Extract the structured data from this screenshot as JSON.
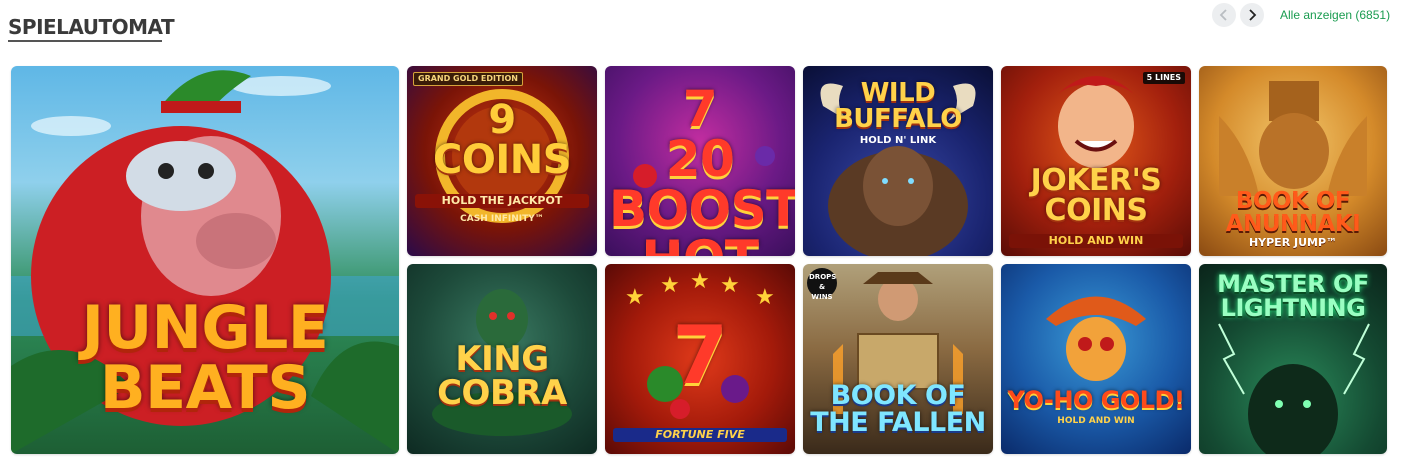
{
  "header": {
    "title": "SPIELAUTOMAT",
    "show_all": "Alle anzeigen (6851)",
    "prev_icon": "chevron-left-icon",
    "next_icon": "chevron-right-icon",
    "accent_color": "#1a9c50"
  },
  "games": [
    {
      "title": "JUNGLE\nBEATS"
    },
    {
      "title": "9\nCOINS",
      "sub": "HOLD THE JACKPOT",
      "sub2": "CASH INFINITY™",
      "badge": "GRAND GOLD EDITION"
    },
    {
      "title": "7\n20 BOOST HOT"
    },
    {
      "title": "WILD\nBUFFALO",
      "sub": "HOLD N' LINK"
    },
    {
      "title": "JOKER'S\nCOINS",
      "sub": "HOLD AND WIN",
      "badge": "5 LINES"
    },
    {
      "title": "BOOK OF\nANUNNAKI",
      "sub": "HYPER JUMP™"
    },
    {
      "title": "KING\nCOBRA"
    },
    {
      "title": "7",
      "sub": "FORTUNE FIVE"
    },
    {
      "title": "BOOK OF\nTHE FALLEN",
      "badge": "DROPS & WINS"
    },
    {
      "title": "YO-HO GOLD!",
      "sub": "HOLD AND WIN"
    },
    {
      "title": "MASTER OF\nLIGHTNING"
    }
  ]
}
